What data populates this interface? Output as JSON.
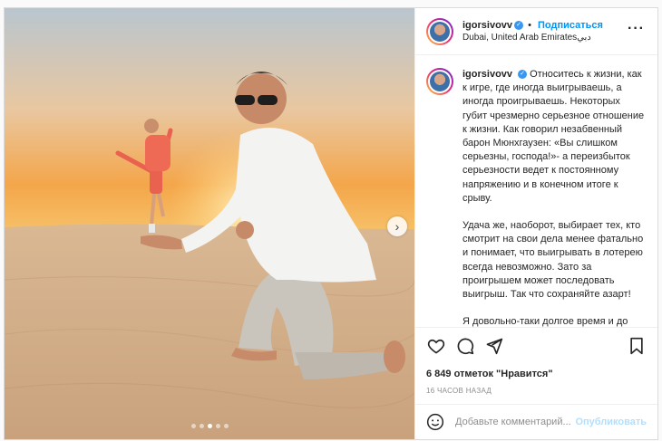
{
  "header": {
    "username": "igorsivovv",
    "follow_label": "Подписаться",
    "separator": "•",
    "location": "Dubai, United Arab Emiratesدبي",
    "more_icon": "more-horizontal-icon"
  },
  "caption": {
    "username": "igorsivovv",
    "paragraph1": "Относитесь к жизни, как к игре, где иногда выигрываешь, а иногда проигрываешь. Некоторых губит чрезмерно серьезное отношение к жизни. Как говорил незабвенный барон Мюнхгаузен: «Вы слишком серьезны, господа!»- а переизбыток серьезности ведет к постоянному напряжению и в конечном итоге к срыву.",
    "paragraph2": "Удача же, наоборот, выбирает тех, кто смотрит на свои дела менее фатально и понимает, что выигрывать в лотерею всегда невозможно. Зато за проигрышем может последовать выигрыш. Так что сохраняйте азарт!",
    "paragraph3": "Я довольно-таки долгое время и до"
  },
  "actions": {
    "icons": [
      "heart-icon",
      "comment-icon",
      "share-icon",
      "bookmark-icon"
    ]
  },
  "likes": "6 849 отметок \"Нравится\"",
  "timestamp": "16 ЧАСОВ НАЗАД",
  "comment": {
    "placeholder": "Добавьте комментарий...",
    "publish_label": "Опубликовать"
  },
  "carousel": {
    "total_dots": 5,
    "active_index": 2
  },
  "colors": {
    "accent": "#0095f6",
    "publish_disabled": "#b2dffc",
    "verified": "#3897f0",
    "muted": "#8e8e8e"
  }
}
